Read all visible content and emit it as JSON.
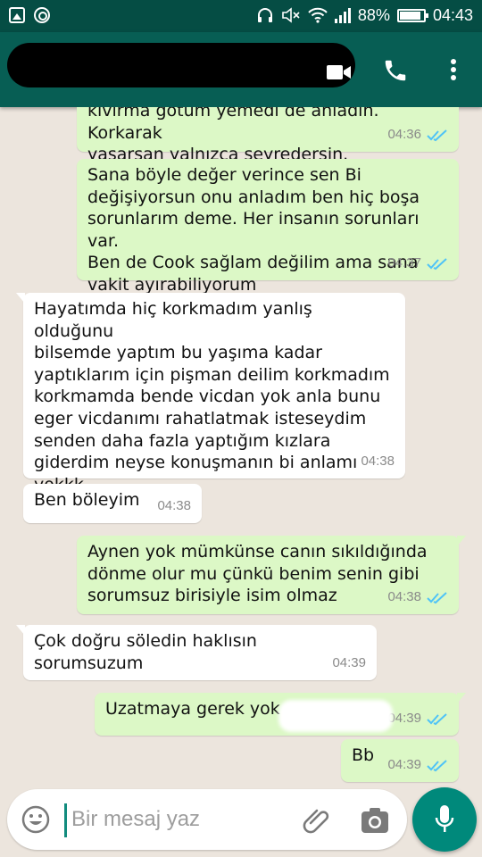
{
  "status_bar": {
    "battery": "88%",
    "battery_level": 0.88,
    "time": "04:43",
    "icons": [
      "image-icon",
      "sync-icon",
      "headphones-icon",
      "mute-icon",
      "wifi-icon",
      "signal-icon",
      "battery-icon"
    ]
  },
  "header": {
    "contact_name_redacted": true,
    "icons": [
      "video-call-icon",
      "phone-icon",
      "more-options-icon"
    ]
  },
  "colors": {
    "status_bar": "#054d44",
    "app_bar": "#075e54",
    "outgoing_bubble": "#dcf8c6",
    "incoming_bubble": "#ffffff",
    "read_ticks": "#4fc3f7",
    "accent": "#00897b"
  },
  "messages": [
    {
      "direction": "out",
      "text": "kıvırma götüm yemedi de anladın. Korkarak\nyaşarsan yalnızca seyredersin.",
      "time": "04:36",
      "status": "read"
    },
    {
      "direction": "out",
      "text": "Sana böyle değer verince sen Bi\ndeğişiyorsun onu anladım ben hiç boşa\nsorunlarım deme. Her insanın sorunları var.\nBen de Cook sağlam değilim ama sana\nvakit ayırabiliyorum",
      "time": "04:37",
      "status": "read"
    },
    {
      "direction": "in",
      "text": "Hayatımda hiç korkmadım yanlış olduğunu\nbilsemde yaptım bu yaşıma kadar\nyaptıklarım için pişman deilim korkmadım\nkorkmamda bende vicdan yok anla bunu\neger vicdanımı rahatlatmak isteseydim\nsenden daha fazla yaptığım kızlara\ngiderdim neyse konuşmanın bi anlamı\nyokkk",
      "time": "04:38"
    },
    {
      "direction": "in",
      "text": "Ben böleyim",
      "time": "04:38"
    },
    {
      "direction": "out",
      "text": "Aynen yok mümkünse canın sıkıldığında\ndönme olur mu çünkü benim senin gibi\nsorumsuz birisiyle isim olmaz",
      "time": "04:38",
      "status": "read"
    },
    {
      "direction": "in",
      "text": "Çok doğru söledin haklısın sorumsuzum",
      "time": "04:39"
    },
    {
      "direction": "out",
      "text": "Uzatmaya gerek yok",
      "time": "04:39",
      "status": "read"
    },
    {
      "direction": "out",
      "text": "Bb",
      "time": "04:39",
      "status": "read"
    }
  ],
  "composer": {
    "placeholder": "Bir mesaj yaz",
    "value": "",
    "icons": [
      "emoji-icon",
      "attach-icon",
      "camera-icon",
      "mic-icon"
    ]
  }
}
